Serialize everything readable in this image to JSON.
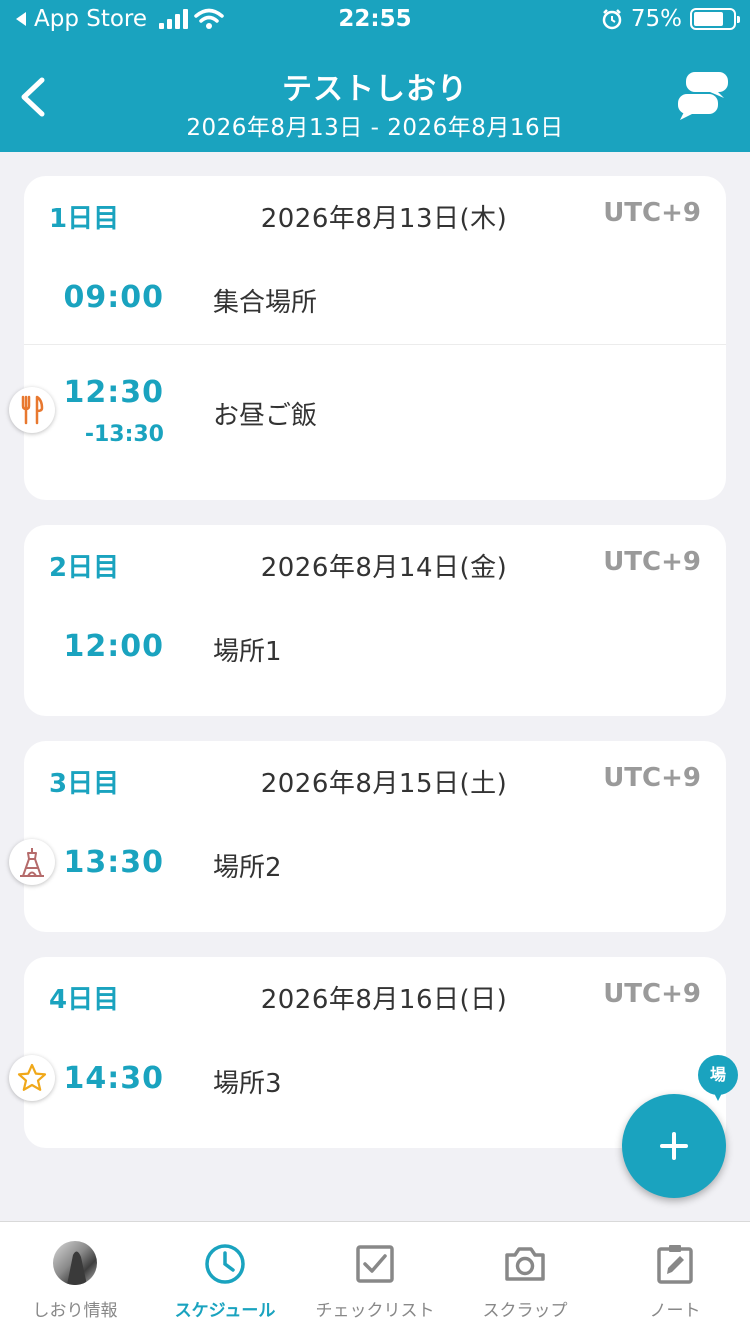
{
  "status_bar": {
    "back_app": "App Store",
    "time": "22:55",
    "battery": "75%",
    "battery_level": 0.75
  },
  "header": {
    "title": "テストしおり",
    "subtitle": "2026年8月13日 - 2026年8月16日"
  },
  "days": [
    {
      "label": "1日目",
      "date": "2026年8月13日(木)",
      "timezone": "UTC+9",
      "items": [
        {
          "time": "09:00",
          "place": "集合場所"
        },
        {
          "time": "12:30",
          "end": "-13:30",
          "place": "お昼ご飯",
          "icon": "utensils-icon"
        }
      ]
    },
    {
      "label": "2日目",
      "date": "2026年8月14日(金)",
      "timezone": "UTC+9",
      "items": [
        {
          "time": "12:00",
          "place": "場所1"
        }
      ]
    },
    {
      "label": "3日目",
      "date": "2026年8月15日(土)",
      "timezone": "UTC+9",
      "items": [
        {
          "time": "13:30",
          "place": "場所2",
          "icon": "landmark-tower-icon"
        }
      ]
    },
    {
      "label": "4日目",
      "date": "2026年8月16日(日)",
      "timezone": "UTC+9",
      "items": [
        {
          "time": "14:30",
          "place": "場所3",
          "icon": "star-icon"
        }
      ]
    }
  ],
  "place_pin": "場",
  "tabs": [
    {
      "label": "しおり情報",
      "icon": "avatar-image"
    },
    {
      "label": "スケジュール",
      "icon": "clock-icon",
      "active": true
    },
    {
      "label": "チェックリスト",
      "icon": "checkbox-icon"
    },
    {
      "label": "スクラップ",
      "icon": "camera-icon"
    },
    {
      "label": "ノート",
      "icon": "note-edit-icon"
    }
  ],
  "colors": {
    "accent": "#1aa3bf",
    "background": "#f1f1f5",
    "utensils": "#e8782f",
    "tower": "#b56b6b",
    "star": "#f0a81a"
  }
}
